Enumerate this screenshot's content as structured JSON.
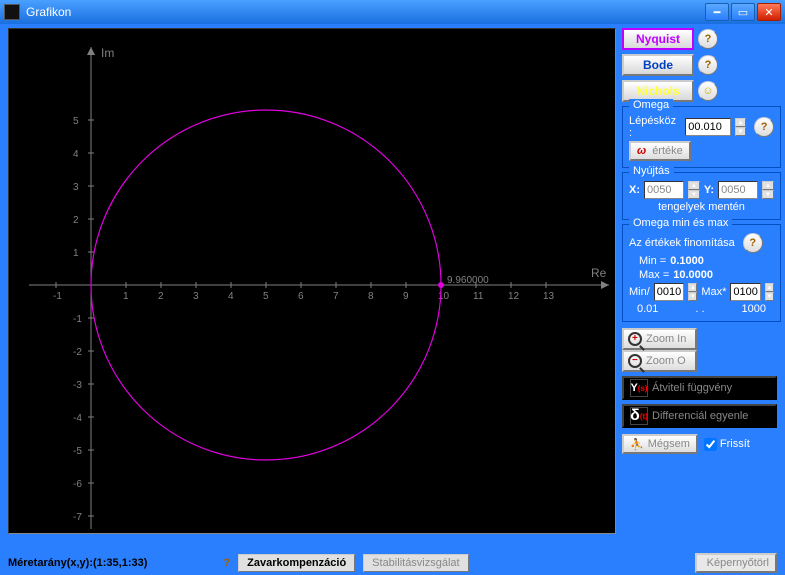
{
  "window": {
    "title": "Grafikon"
  },
  "plot": {
    "x_label": "Re",
    "y_label": "Im",
    "x_ticks": [
      -1,
      1,
      2,
      3,
      4,
      5,
      6,
      7,
      8,
      9,
      10,
      11,
      12,
      13
    ],
    "y_ticks": [
      5,
      4,
      3,
      2,
      1,
      -1,
      -2,
      -3,
      -4,
      -5,
      -6,
      -7
    ],
    "marker_value": "9.960000"
  },
  "chart_data": {
    "type": "line",
    "title": "Nyquist",
    "xlabel": "Re",
    "ylabel": "Im",
    "xlim": [
      -1.5,
      13.5
    ],
    "ylim": [
      -7.5,
      5.5
    ],
    "series": [
      {
        "name": "Nyquist curve",
        "shape": "circle",
        "center_re": 5,
        "center_im": 0,
        "radius": 5
      }
    ],
    "markers": [
      {
        "re": 10,
        "im": 0,
        "label": "9.960000"
      }
    ]
  },
  "buttons": {
    "nyquist": "Nyquist",
    "bode": "Bode",
    "nichols": "Nichols",
    "zoom_in": "Zoom In",
    "zoom_out": "Zoom O",
    "atvitel": "Átviteli függvény",
    "diff": "Differenciál egyenle",
    "megsem": "Mégsem",
    "frissit": "Frissít",
    "kepernyo": "Képernyőtörl",
    "omega_ertek": "értéke"
  },
  "omega": {
    "legend": "Omega",
    "step_label": "Lépésköz :",
    "step_value": "00.010"
  },
  "stretch": {
    "legend": "Nyújtás",
    "x_label": "X:",
    "y_label": "Y:",
    "x_value": "0050",
    "y_value": "0050",
    "axes_label": "tengelyek mentén"
  },
  "minmax": {
    "legend": "Omega min és max",
    "refine_label": "Az értékek finomítása",
    "min_label": "Min =",
    "min_value": "0.1000",
    "max_label": "Max =",
    "max_value": "10.0000",
    "minf_label": "Min/",
    "minf_value": "0010",
    "maxf_label": "Max*",
    "maxf_value": "0100",
    "scale_left": "0.01",
    "scale_dots": ". .",
    "scale_right": "1000"
  },
  "status": {
    "aspect": "Méretarány(x,y):(1:35,1:33)",
    "zavar": "Zavarkompenzáció",
    "stab": "Stabilitásvizsgálat"
  }
}
